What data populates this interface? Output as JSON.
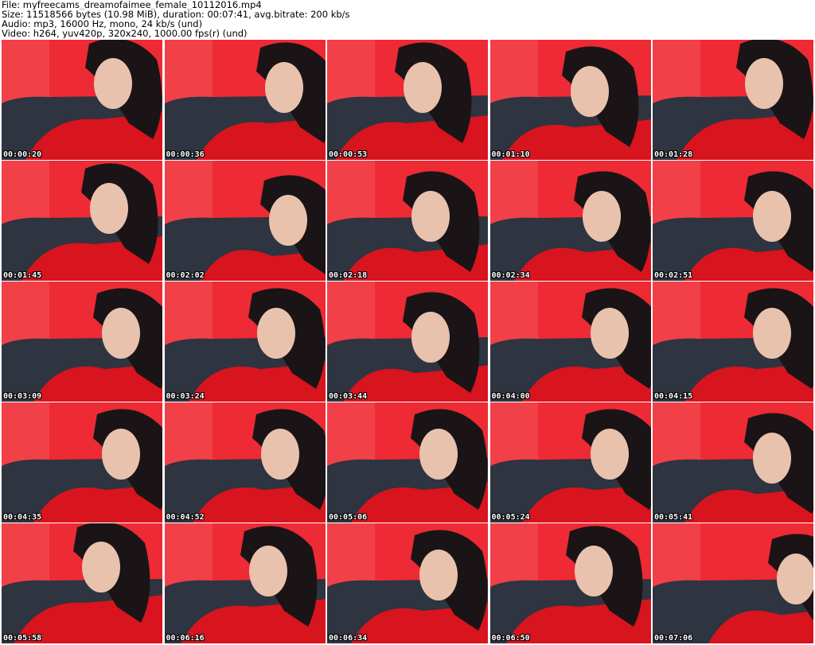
{
  "header": {
    "lines": [
      "File: myfreecams_dreamofaimee_female_10112016.mp4",
      "Size: 11518566 bytes (10.98 MiB), duration: 00:07:41, avg.bitrate: 200 kb/s",
      "Audio: mp3, 16000 Hz, mono, 24 kb/s (und)",
      "Video: h264, yuv420p, 320x240, 1000.00 fps(r) (und)"
    ]
  },
  "frames": [
    {
      "timestamp": "00:00:20"
    },
    {
      "timestamp": "00:00:36"
    },
    {
      "timestamp": "00:00:53"
    },
    {
      "timestamp": "00:01:10"
    },
    {
      "timestamp": "00:01:28"
    },
    {
      "timestamp": "00:01:45"
    },
    {
      "timestamp": "00:02:02"
    },
    {
      "timestamp": "00:02:18"
    },
    {
      "timestamp": "00:02:34"
    },
    {
      "timestamp": "00:02:51"
    },
    {
      "timestamp": "00:03:09"
    },
    {
      "timestamp": "00:03:24"
    },
    {
      "timestamp": "00:03:44"
    },
    {
      "timestamp": "00:04:00"
    },
    {
      "timestamp": "00:04:15"
    },
    {
      "timestamp": "00:04:35"
    },
    {
      "timestamp": "00:04:52"
    },
    {
      "timestamp": "00:05:06"
    },
    {
      "timestamp": "00:05:24"
    },
    {
      "timestamp": "00:05:41"
    },
    {
      "timestamp": "00:05:58"
    },
    {
      "timestamp": "00:06:16"
    },
    {
      "timestamp": "00:06:34"
    },
    {
      "timestamp": "00:06:50"
    },
    {
      "timestamp": "00:07:06"
    }
  ],
  "colors": {
    "wall": "#ee2a34",
    "wall_light": "#f4555c",
    "sofa": "#2e3440",
    "sweater": "#d8141e",
    "hair": "#1a1416",
    "skin": "#e9c2ae"
  }
}
